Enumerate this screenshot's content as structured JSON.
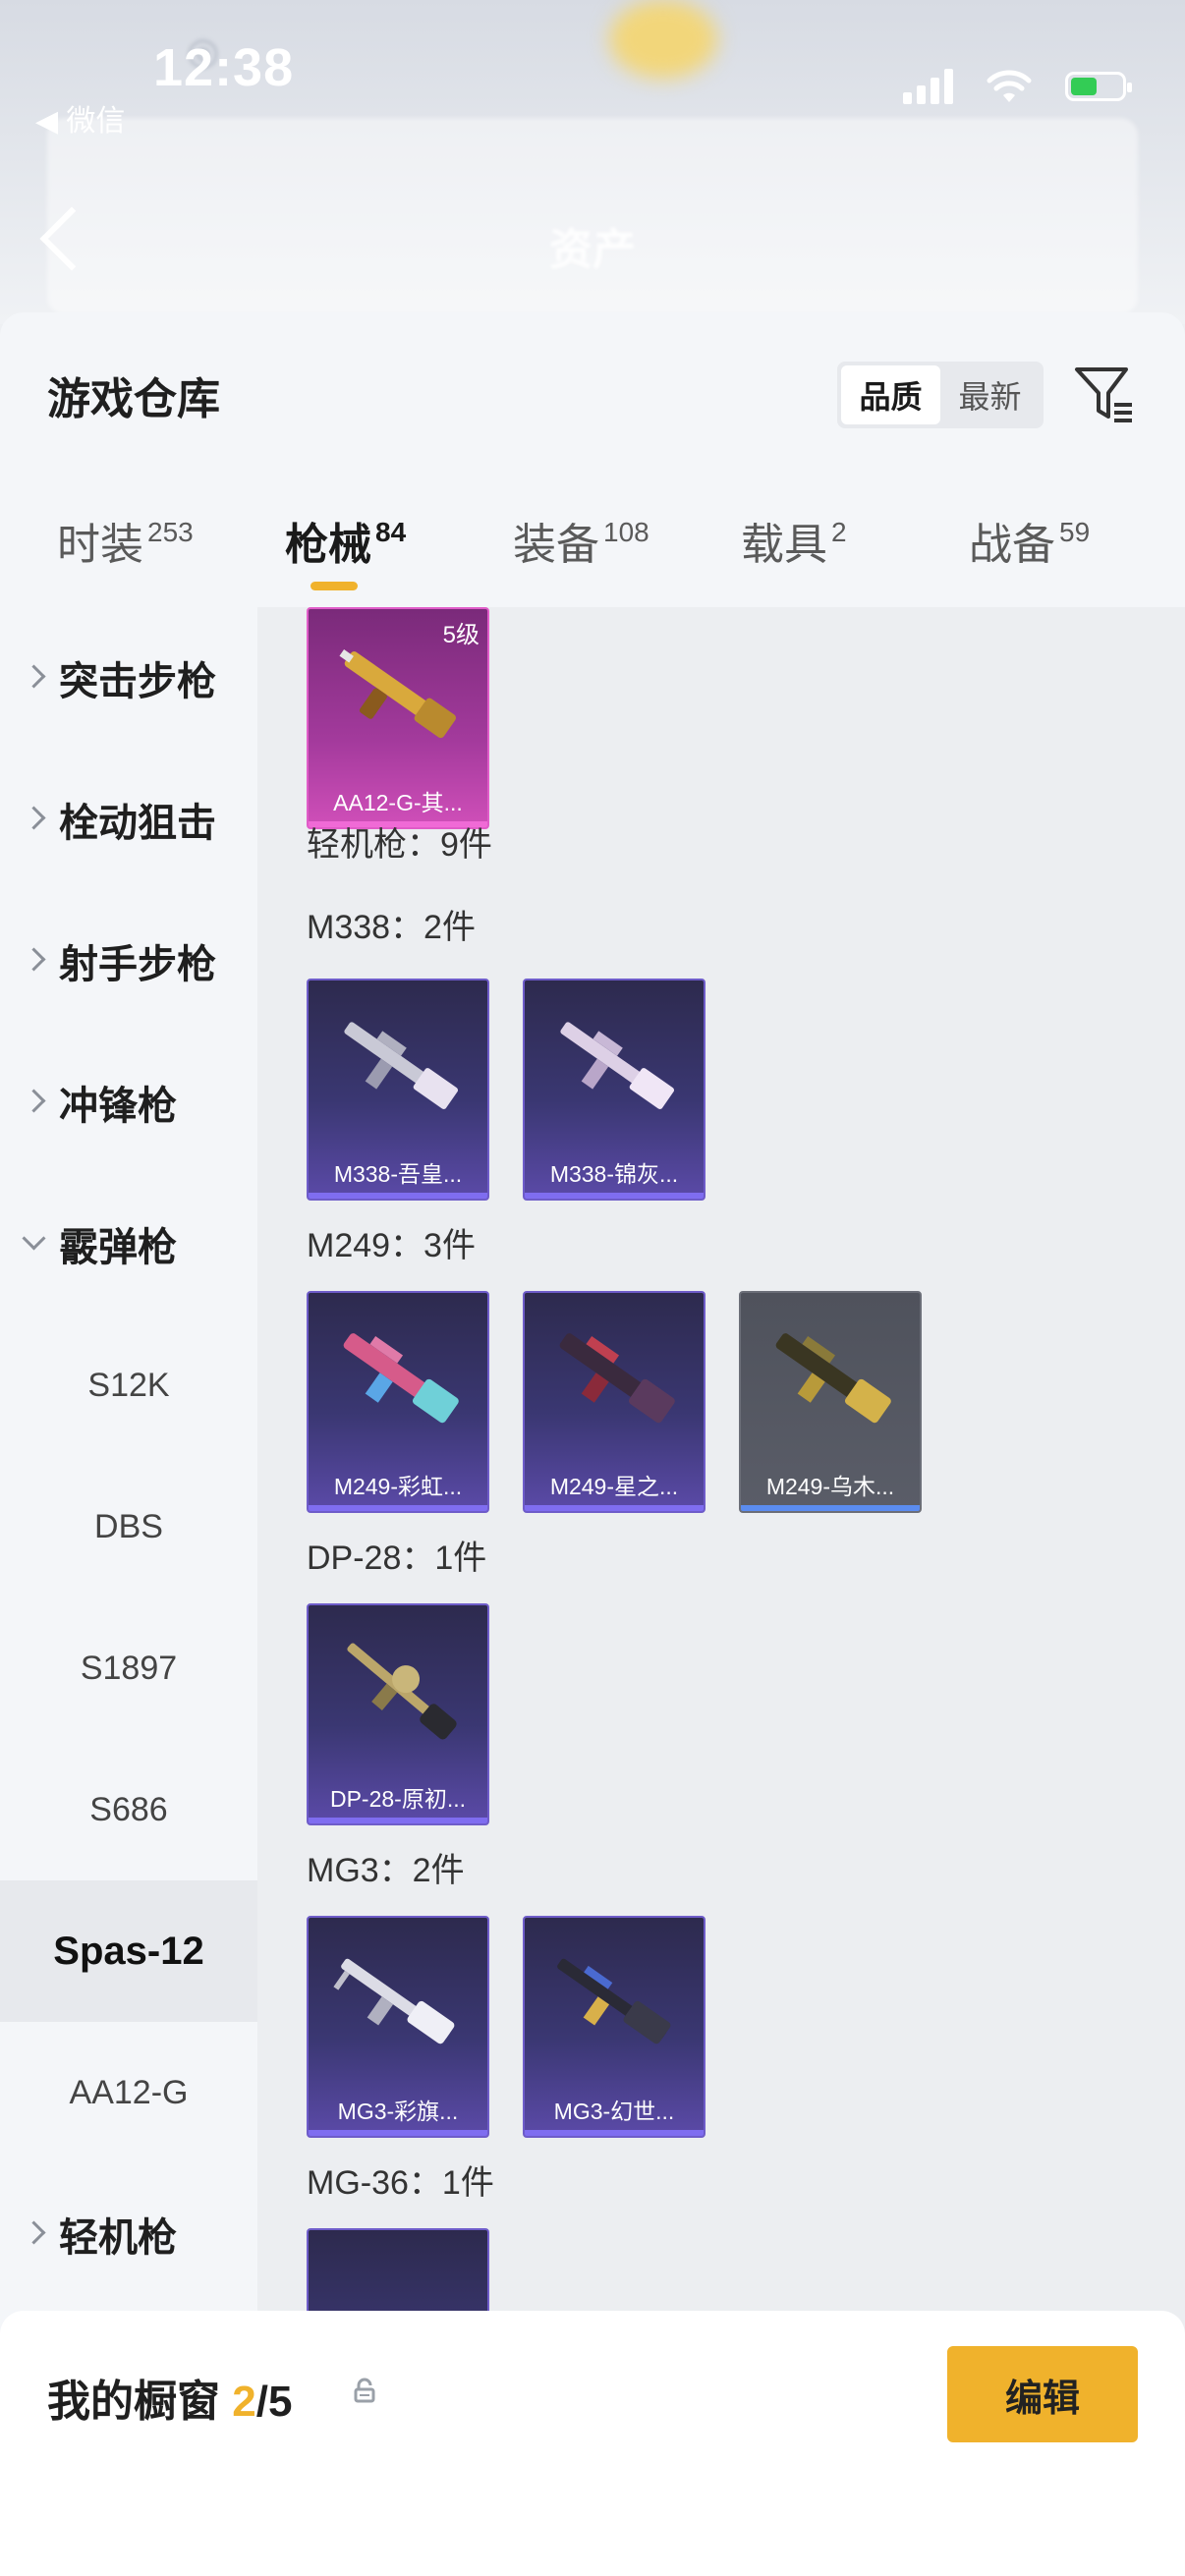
{
  "status_bar": {
    "time": "12:38",
    "back_app": "◀ 微信"
  },
  "nav": {
    "title": "资产"
  },
  "sheet": {
    "title": "游戏仓库",
    "sort": {
      "options": [
        "品质",
        "最新"
      ],
      "selected": "品质"
    },
    "filter_icon": "filter-icon"
  },
  "tabs": [
    {
      "label": "时装",
      "count": "253",
      "active": false
    },
    {
      "label": "枪械",
      "count": "84",
      "active": true
    },
    {
      "label": "装备",
      "count": "108",
      "active": false
    },
    {
      "label": "载具",
      "count": "2",
      "active": false
    },
    {
      "label": "战备",
      "count": "59",
      "active": false
    }
  ],
  "left_nav": [
    {
      "label": "突击步枪",
      "type": "category",
      "expanded": false
    },
    {
      "label": "栓动狙击",
      "type": "category",
      "expanded": false
    },
    {
      "label": "射手步枪",
      "type": "category",
      "expanded": false
    },
    {
      "label": "冲锋枪",
      "type": "category",
      "expanded": false
    },
    {
      "label": "霰弹枪",
      "type": "category",
      "expanded": true
    },
    {
      "label": "S12K",
      "type": "sub"
    },
    {
      "label": "DBS",
      "type": "sub"
    },
    {
      "label": "S1897",
      "type": "sub"
    },
    {
      "label": "S686",
      "type": "sub"
    },
    {
      "label": "Spas-12",
      "type": "sub",
      "active": true
    },
    {
      "label": "AA12-G",
      "type": "sub"
    },
    {
      "label": "轻机枪",
      "type": "category",
      "expanded": false
    }
  ],
  "content": {
    "top_item": {
      "name": "AA12-G-其...",
      "level": "5级",
      "rarity": "pink"
    },
    "category_header": "轻机枪：9件",
    "groups": [
      {
        "label": "M338：2件",
        "items": [
          {
            "name": "M338-吾皇..."
          },
          {
            "name": "M338-锦灰..."
          }
        ]
      },
      {
        "label": "M249：3件",
        "items": [
          {
            "name": "M249-彩虹..."
          },
          {
            "name": "M249-星之..."
          },
          {
            "name": "M249-乌木...",
            "rarity": "gray"
          }
        ]
      },
      {
        "label": "DP-28：1件",
        "items": [
          {
            "name": "DP-28-原初..."
          }
        ]
      },
      {
        "label": "MG3：2件",
        "items": [
          {
            "name": "MG3-彩旗..."
          },
          {
            "name": "MG3-幻世..."
          }
        ]
      },
      {
        "label": "MG-36：1件",
        "items": []
      }
    ]
  },
  "fab": {
    "icon": "share-out-icon"
  },
  "showcase": {
    "label": "我的橱窗",
    "used": "2",
    "total": "/5",
    "edit_label": "编辑",
    "lock_icon": "lock-icon"
  },
  "colors": {
    "accent": "#f0b22c",
    "epic": "#6e5cc9",
    "legendary": "#e05cc8"
  }
}
